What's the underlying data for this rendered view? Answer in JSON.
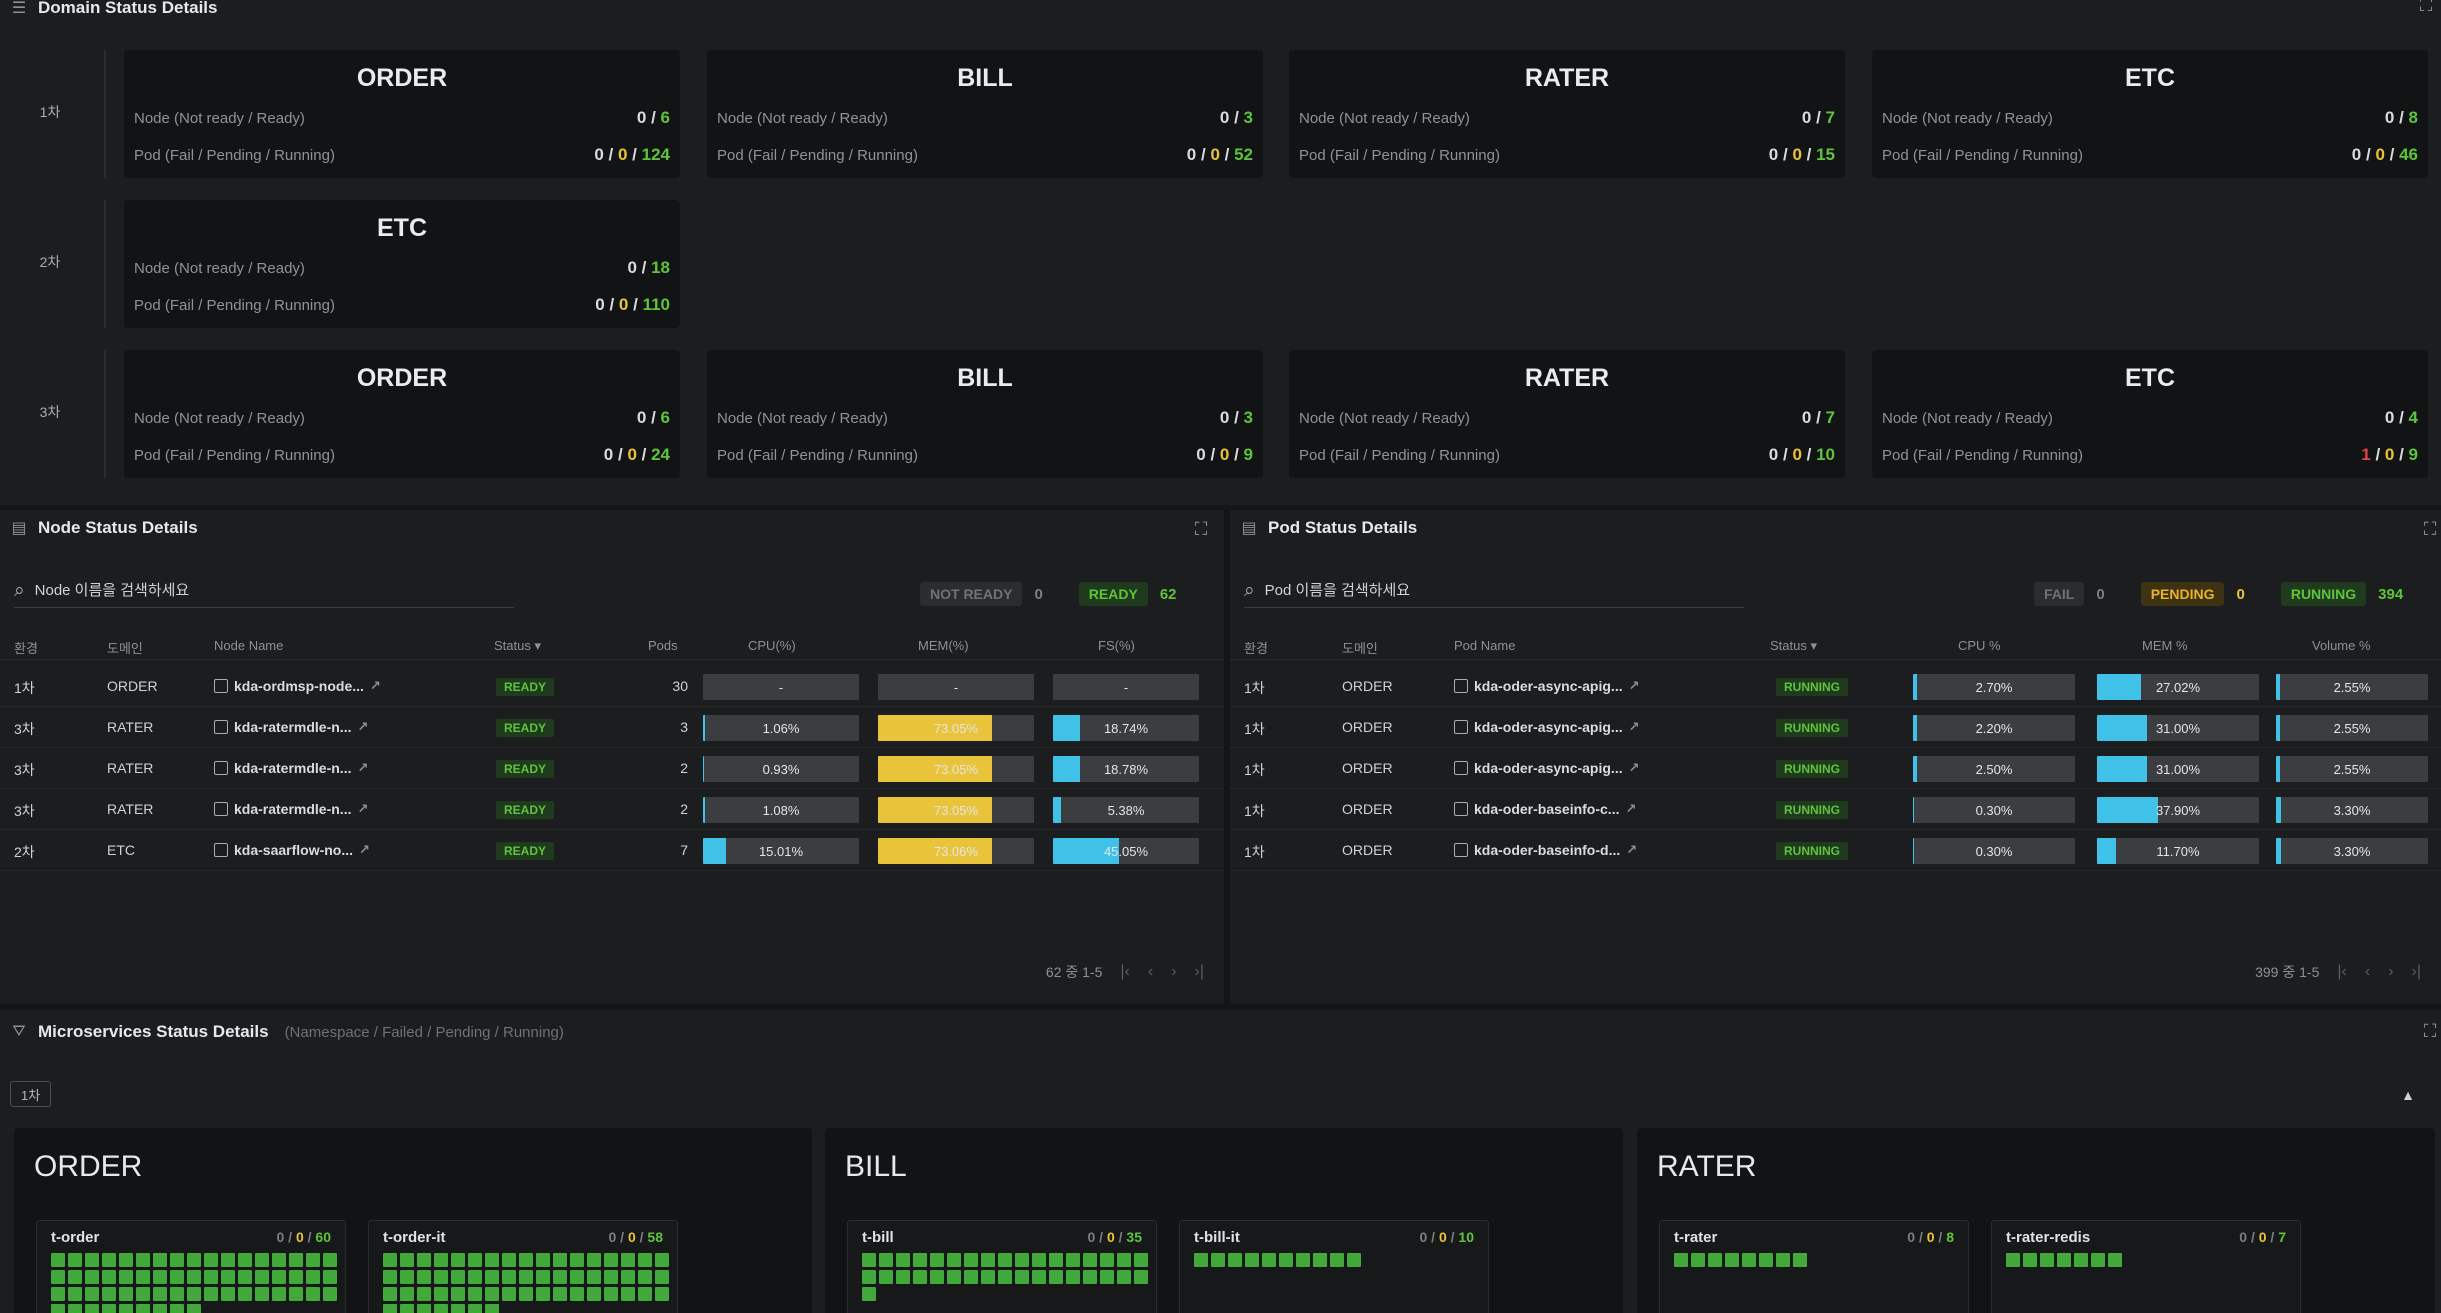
{
  "domain_panel": {
    "title": "Domain Status Details",
    "rows": [
      {
        "label": "1차",
        "cards": [
          {
            "name": "ORDER",
            "node_label": "Node (Not ready / Ready)",
            "node_nr": "0",
            "node_r": "6",
            "pod_label": "Pod (Fail / Pending / Running)",
            "pod_f": "0",
            "pod_p": "0",
            "pod_r": "124"
          },
          {
            "name": "BILL",
            "node_label": "Node (Not ready / Ready)",
            "node_nr": "0",
            "node_r": "3",
            "pod_label": "Pod (Fail / Pending / Running)",
            "pod_f": "0",
            "pod_p": "0",
            "pod_r": "52"
          },
          {
            "name": "RATER",
            "node_label": "Node (Not ready / Ready)",
            "node_nr": "0",
            "node_r": "7",
            "pod_label": "Pod (Fail / Pending / Running)",
            "pod_f": "0",
            "pod_p": "0",
            "pod_r": "15"
          },
          {
            "name": "ETC",
            "node_label": "Node (Not ready / Ready)",
            "node_nr": "0",
            "node_r": "8",
            "pod_label": "Pod (Fail / Pending / Running)",
            "pod_f": "0",
            "pod_p": "0",
            "pod_r": "46"
          }
        ]
      },
      {
        "label": "2차",
        "cards": [
          {
            "name": "ETC",
            "node_label": "Node (Not ready / Ready)",
            "node_nr": "0",
            "node_r": "18",
            "pod_label": "Pod (Fail / Pending / Running)",
            "pod_f": "0",
            "pod_p": "0",
            "pod_r": "110"
          }
        ]
      },
      {
        "label": "3차",
        "cards": [
          {
            "name": "ORDER",
            "node_label": "Node (Not ready / Ready)",
            "node_nr": "0",
            "node_r": "6",
            "pod_label": "Pod (Fail / Pending / Running)",
            "pod_f": "0",
            "pod_p": "0",
            "pod_r": "24"
          },
          {
            "name": "BILL",
            "node_label": "Node (Not ready / Ready)",
            "node_nr": "0",
            "node_r": "3",
            "pod_label": "Pod (Fail / Pending / Running)",
            "pod_f": "0",
            "pod_p": "0",
            "pod_r": "9"
          },
          {
            "name": "RATER",
            "node_label": "Node (Not ready / Ready)",
            "node_nr": "0",
            "node_r": "7",
            "pod_label": "Pod (Fail / Pending / Running)",
            "pod_f": "0",
            "pod_p": "0",
            "pod_r": "10"
          },
          {
            "name": "ETC",
            "node_label": "Node (Not ready / Ready)",
            "node_nr": "0",
            "node_r": "4",
            "pod_label": "Pod (Fail / Pending / Running)",
            "pod_f": "1",
            "pod_p": "0",
            "pod_r": "9"
          }
        ]
      }
    ]
  },
  "node_panel": {
    "title": "Node Status Details",
    "search_placeholder": "Node 이름을 검색하세요",
    "not_ready_label": "NOT READY",
    "not_ready_count": "0",
    "ready_label": "READY",
    "ready_count": "62",
    "columns": [
      "환경",
      "도메인",
      "Node Name",
      "Status",
      "Pods",
      "CPU(%)",
      "MEM(%)",
      "FS(%)"
    ],
    "rows": [
      {
        "env": "1차",
        "domain": "ORDER",
        "name": "kda-ordmsp-node...",
        "status": "READY",
        "pods": "30",
        "cpu": "-",
        "cpu_v": 0,
        "mem": "-",
        "mem_v": 0,
        "fs": "-",
        "fs_v": 0
      },
      {
        "env": "3차",
        "domain": "RATER",
        "name": "kda-ratermdle-n...",
        "status": "READY",
        "pods": "3",
        "cpu": "1.06%",
        "cpu_v": 1.06,
        "mem": "73.05%",
        "mem_v": 73.05,
        "fs": "18.74%",
        "fs_v": 18.74
      },
      {
        "env": "3차",
        "domain": "RATER",
        "name": "kda-ratermdle-n...",
        "status": "READY",
        "pods": "2",
        "cpu": "0.93%",
        "cpu_v": 0.93,
        "mem": "73.05%",
        "mem_v": 73.05,
        "fs": "18.78%",
        "fs_v": 18.78
      },
      {
        "env": "3차",
        "domain": "RATER",
        "name": "kda-ratermdle-n...",
        "status": "READY",
        "pods": "2",
        "cpu": "1.08%",
        "cpu_v": 1.08,
        "mem": "73.05%",
        "mem_v": 73.05,
        "fs": "5.38%",
        "fs_v": 5.38
      },
      {
        "env": "2차",
        "domain": "ETC",
        "name": "kda-saarflow-no...",
        "status": "READY",
        "pods": "7",
        "cpu": "15.01%",
        "cpu_v": 15.01,
        "mem": "73.06%",
        "mem_v": 73.06,
        "fs": "45.05%",
        "fs_v": 45.05
      }
    ],
    "pager_text": "62 중 1-5",
    "pager_icons": [
      "|‹",
      "‹",
      "›",
      "›|"
    ]
  },
  "pod_panel": {
    "title": "Pod Status Details",
    "search_placeholder": "Pod 이름을 검색하세요",
    "fail_label": "FAIL",
    "fail_count": "0",
    "pending_label": "PENDING",
    "pending_count": "0",
    "running_label": "RUNNING",
    "running_count": "394",
    "columns": [
      "환경",
      "도메인",
      "Pod Name",
      "Status",
      "CPU %",
      "MEM %",
      "Volume %"
    ],
    "rows": [
      {
        "env": "1차",
        "domain": "ORDER",
        "name": "kda-oder-async-apig...",
        "status": "RUNNING",
        "cpu": "2.70%",
        "cpu_v": 2.7,
        "mem": "27.02%",
        "mem_v": 27.02,
        "vol": "2.55%",
        "vol_v": 2.55
      },
      {
        "env": "1차",
        "domain": "ORDER",
        "name": "kda-oder-async-apig...",
        "status": "RUNNING",
        "cpu": "2.20%",
        "cpu_v": 2.2,
        "mem": "31.00%",
        "mem_v": 31.0,
        "vol": "2.55%",
        "vol_v": 2.55
      },
      {
        "env": "1차",
        "domain": "ORDER",
        "name": "kda-oder-async-apig...",
        "status": "RUNNING",
        "cpu": "2.50%",
        "cpu_v": 2.5,
        "mem": "31.00%",
        "mem_v": 31.0,
        "vol": "2.55%",
        "vol_v": 2.55
      },
      {
        "env": "1차",
        "domain": "ORDER",
        "name": "kda-oder-baseinfo-c...",
        "status": "RUNNING",
        "cpu": "0.30%",
        "cpu_v": 0.3,
        "mem": "37.90%",
        "mem_v": 37.9,
        "vol": "3.30%",
        "vol_v": 3.3
      },
      {
        "env": "1차",
        "domain": "ORDER",
        "name": "kda-oder-baseinfo-d...",
        "status": "RUNNING",
        "cpu": "0.30%",
        "cpu_v": 0.3,
        "mem": "11.70%",
        "mem_v": 11.7,
        "vol": "3.30%",
        "vol_v": 3.3
      }
    ],
    "pager_text": "399 중 1-5",
    "pager_icons": [
      "|‹",
      "‹",
      "›",
      "›|"
    ]
  },
  "ms_panel": {
    "title": "Microservices Status Details",
    "subtitle": "(Namespace / Failed / Pending / Running)",
    "tag": "1차",
    "collapse_icon": "▲",
    "cards": [
      {
        "name": "ORDER",
        "services": [
          {
            "name": "t-order",
            "failed": "0",
            "pending": "0",
            "running": "60",
            "dots": 60
          },
          {
            "name": "t-order-it",
            "failed": "0",
            "pending": "0",
            "running": "58",
            "dots": 58
          }
        ]
      },
      {
        "name": "BILL",
        "services": [
          {
            "name": "t-bill",
            "failed": "0",
            "pending": "0",
            "running": "35",
            "dots": 35
          },
          {
            "name": "t-bill-it",
            "failed": "0",
            "pending": "0",
            "running": "10",
            "dots": 10
          }
        ]
      },
      {
        "name": "RATER",
        "services": [
          {
            "name": "t-rater",
            "failed": "0",
            "pending": "0",
            "running": "8",
            "dots": 8
          },
          {
            "name": "t-rater-redis",
            "failed": "0",
            "pending": "0",
            "running": "7",
            "dots": 7
          }
        ]
      }
    ]
  },
  "colors": {
    "green": "#5ec43c",
    "yellow": "#e9c43a",
    "blue": "#3fc1e8",
    "red": "#e04444",
    "bg": "#141516"
  },
  "icons": {
    "domain": "list-icon",
    "node": "server-icon",
    "pod": "server-icon",
    "ms": "filter-icon",
    "expand": "expand-icon",
    "search": "search-icon"
  }
}
